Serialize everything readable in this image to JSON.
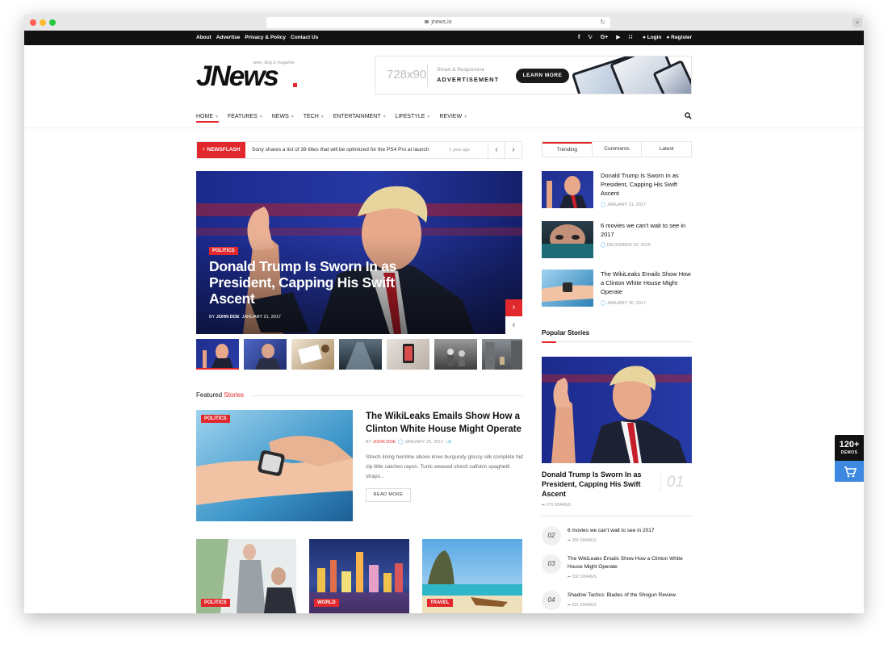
{
  "browser": {
    "url": "jnews.io"
  },
  "topbar": {
    "links": [
      "About",
      "Advertise",
      "Privacy & Policy",
      "Contact Us"
    ],
    "login": "Login",
    "register": "Register"
  },
  "header": {
    "logo_text": "JNews",
    "logo_tagline": "news, blog & magazine",
    "ad": {
      "size": "728x90",
      "line1": "Smart & Responsive",
      "line2": "ADVERTISEMENT",
      "button": "LEARN MORE"
    }
  },
  "nav": {
    "items": [
      "HOME",
      "FEATURES",
      "NEWS",
      "TECH",
      "ENTERTAINMENT",
      "LIFESTYLE",
      "REVIEW"
    ],
    "active_index": 0
  },
  "newsflash": {
    "label": "NEWSFLASH",
    "text": "Sony shares a list of 39 titles that will be optimized for the PS4 Pro at launch",
    "time": "1 year ago"
  },
  "hero": {
    "category": "POLITICS",
    "title": "Donald Trump Is Sworn In as President, Capping His Swift Ascent",
    "by": "BY",
    "author": "JOHN DOE",
    "date": "JANUARY 21, 2017"
  },
  "featured": {
    "heading_1": "Featured",
    "heading_2": "Stories",
    "category": "POLITICS",
    "title": "The WikiLeaks Emails Show How a Clinton White House Might Operate",
    "by": "BY",
    "author": "JOHN DOE",
    "date": "JANUARY 20, 2017",
    "comments": "5",
    "excerpt": "Strech lining hemline above knee burgundy glossy silk complete hid zip little catches rayon. Tunic weaved strech calfskin spaghetti straps...",
    "read_more": "READ MORE",
    "cards": [
      {
        "category": "POLITICS"
      },
      {
        "category": "WORLD"
      },
      {
        "category": "TRAVEL"
      }
    ]
  },
  "sidebar": {
    "tabs": [
      "Trending",
      "Comments",
      "Latest"
    ],
    "trending": [
      {
        "title": "Donald Trump Is Sworn In as President, Capping His Swift Ascent",
        "date": "JANUARY 21, 2017"
      },
      {
        "title": "6 movies we can't wait to see in 2017",
        "date": "DECEMBER 29, 2016"
      },
      {
        "title": "The WikiLeaks Emails Show How a Clinton White House Might Operate",
        "date": "JANUARY 20, 2017"
      }
    ],
    "popular_heading": "Popular Stories",
    "popular_top": {
      "title": "Donald Trump Is Sworn In as President, Capping His Swift Ascent",
      "rank": "01",
      "shares": "370 SHARES"
    },
    "popular_list": [
      {
        "rank": "02",
        "title": "6 movies we can't wait to see in 2017",
        "shares": "356 SHARES"
      },
      {
        "rank": "03",
        "title": "The WikiLeaks Emails Show How a Clinton White House Might Operate",
        "shares": "332 SHARES"
      },
      {
        "rank": "04",
        "title": "Shadow Tactics: Blades of the Shogun Review",
        "shares": "321 SHARES"
      }
    ]
  },
  "demos_badge": {
    "count": "120+",
    "label": "DEMOS"
  },
  "colors": {
    "accent": "#e2282c",
    "dark": "#121212",
    "link_blue": "#2e9fe8",
    "cart_blue": "#3d88e0"
  }
}
